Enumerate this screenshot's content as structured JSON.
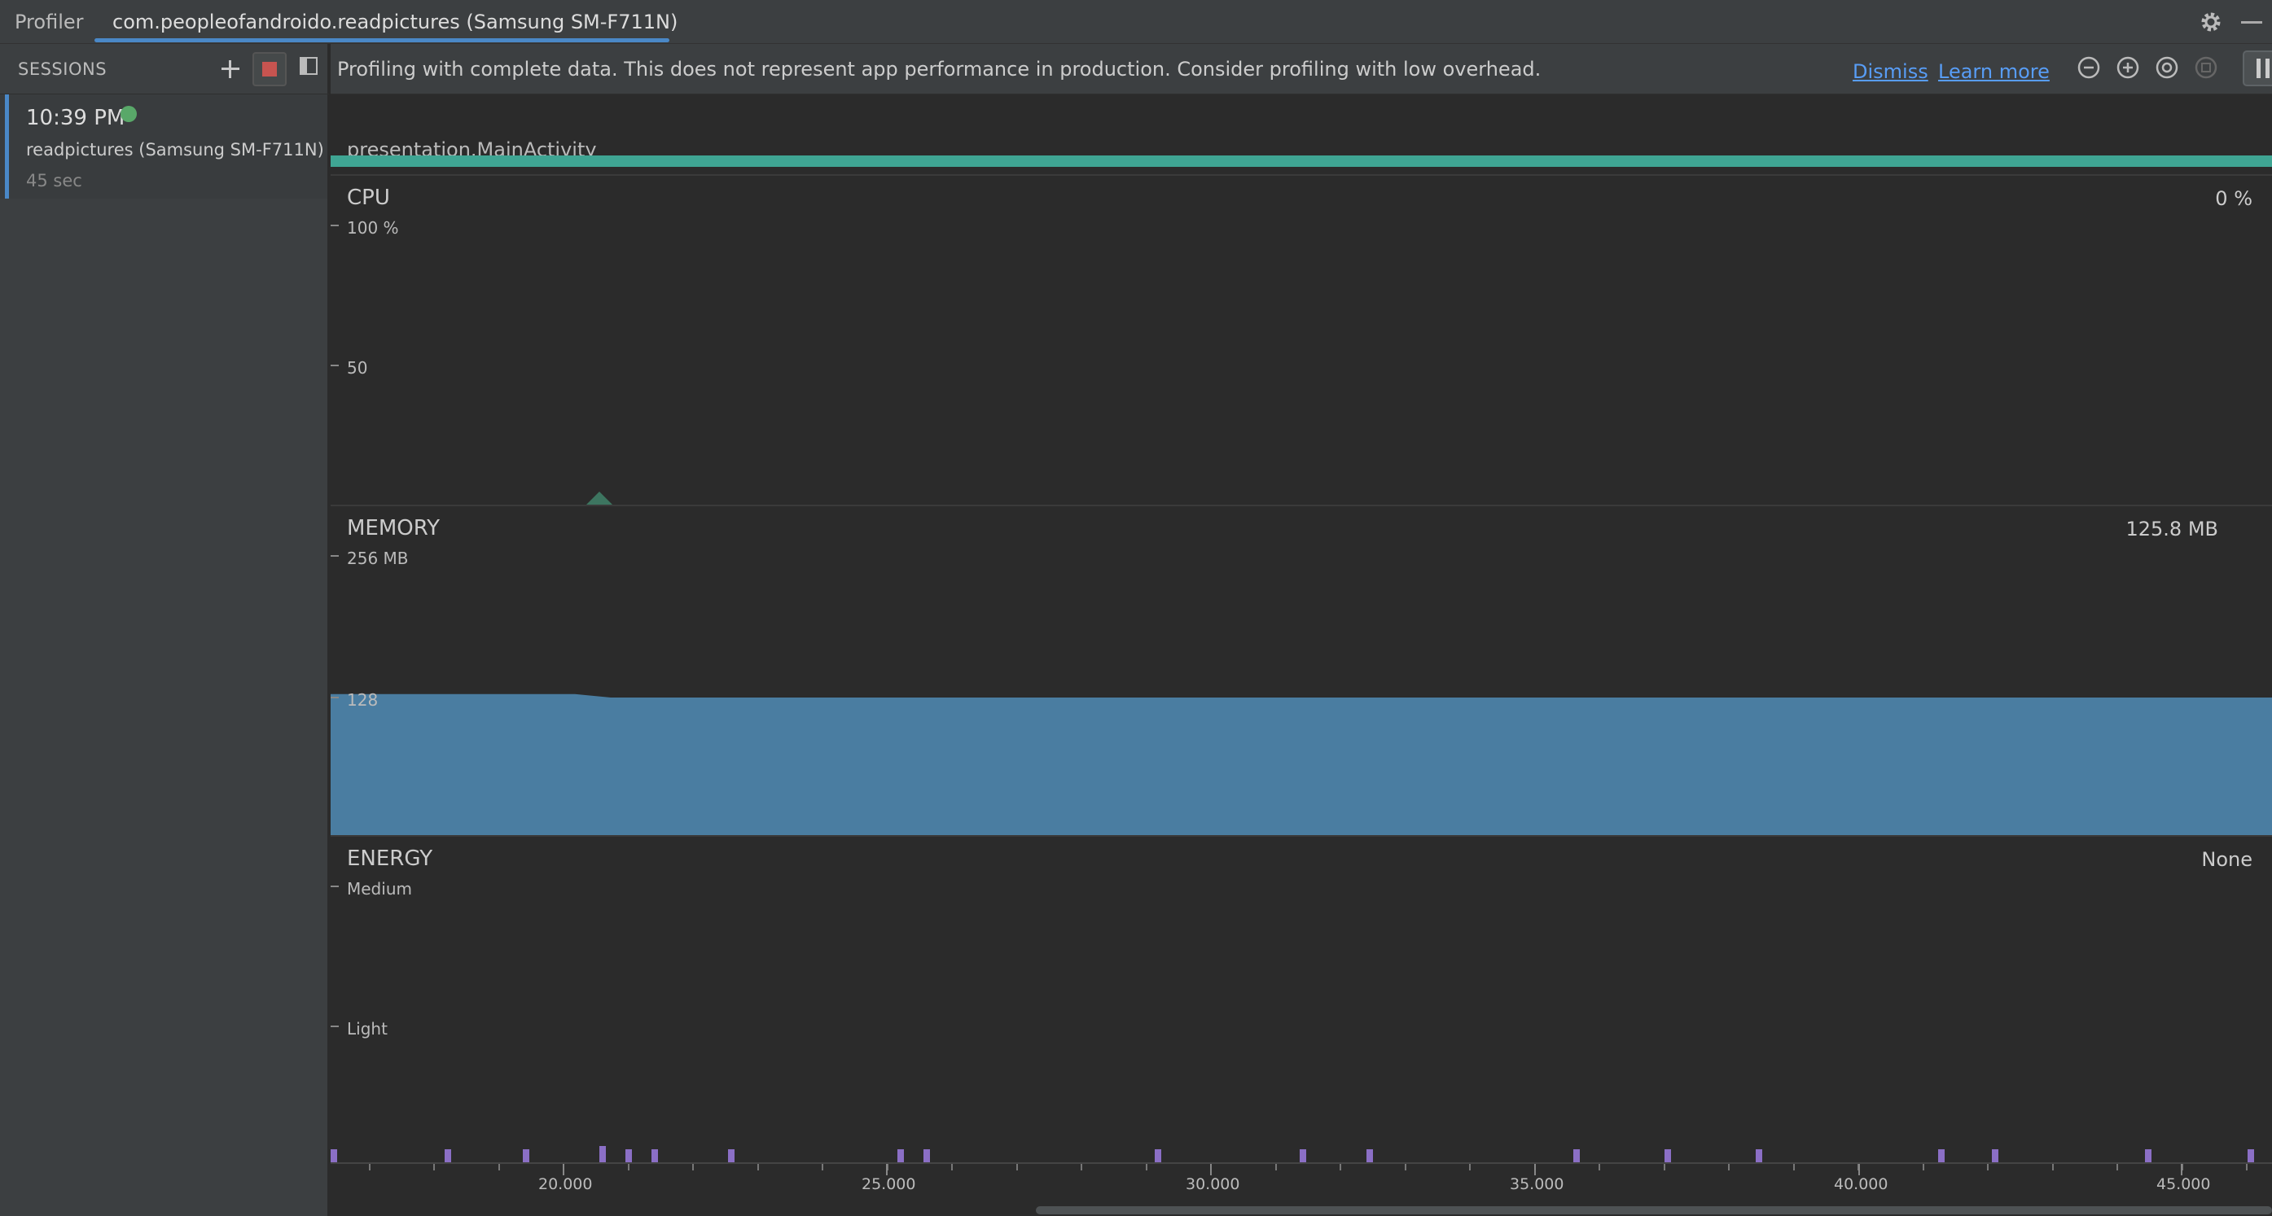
{
  "app": {
    "title": "Profiler",
    "session_tab": "com.peopleofandroido.readpictures (Samsung SM-F711N)"
  },
  "sidebar": {
    "header": "SESSIONS",
    "session": {
      "time": "10:39 PM",
      "name": "readpictures (Samsung SM-F711N)",
      "duration": "45 sec"
    }
  },
  "banner": {
    "message": "Profiling with complete data. This does not represent app performance in production. Consider profiling with low overhead.",
    "dismiss": "Dismiss",
    "learn_more": "Learn more"
  },
  "activity": {
    "label": "presentation.MainActivity"
  },
  "monitors": {
    "cpu": {
      "title": "CPU",
      "value": "0 %",
      "axis_max": "100 %",
      "axis_mid": "50"
    },
    "memory": {
      "title": "MEMORY",
      "value": "125.8 MB",
      "axis_max": "256 MB",
      "axis_mid": "128",
      "fill_color": "#4a7da1",
      "series_mb": [
        129,
        129,
        129,
        125.8,
        125.8,
        125.8,
        125.8
      ]
    },
    "energy": {
      "title": "ENERGY",
      "value": "None",
      "axis_max": "Medium",
      "axis_mid": "Light",
      "event_color": "#8b6fc6"
    }
  },
  "time_axis": {
    "labels": [
      "20.000",
      "25.000",
      "30.000",
      "35.000",
      "40.000",
      "45.000"
    ]
  },
  "colors": {
    "accent": "#4a88c7",
    "activity_bar": "#3fa593",
    "link": "#589df6",
    "live_dot": "#59a869",
    "stop": "#c75450"
  }
}
